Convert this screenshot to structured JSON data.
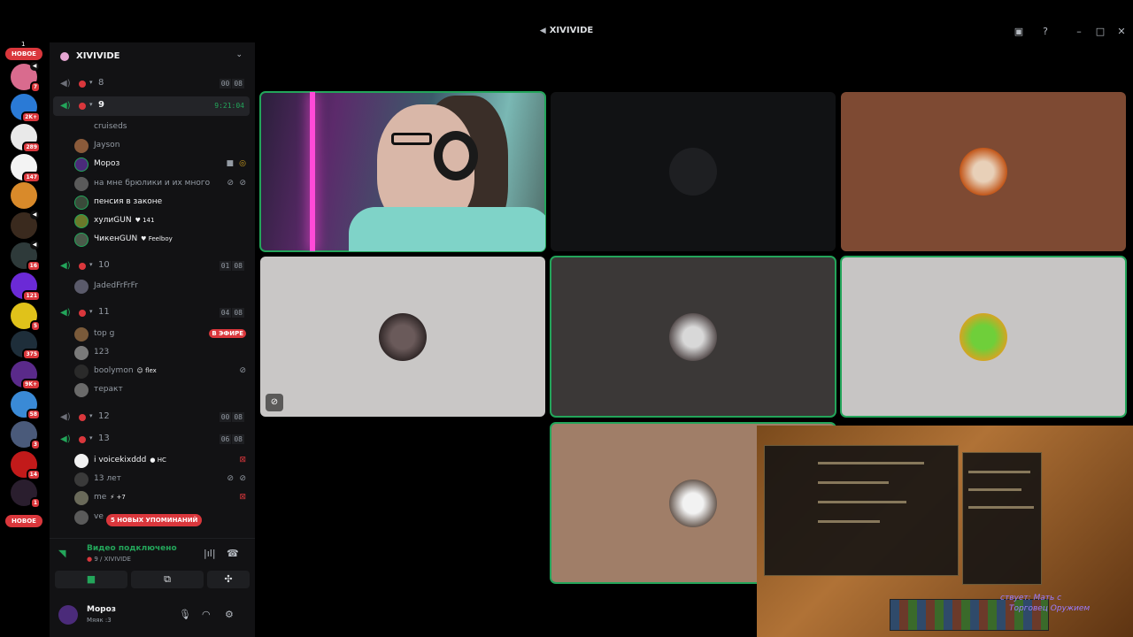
{
  "window": {
    "title": "XIVIVIDE"
  },
  "rail": {
    "new_top": "НОВОЕ",
    "new_bottom": "НОВОЕ",
    "top_count": "1",
    "badges": [
      "7",
      "2K+",
      "289",
      "147",
      "",
      "",
      "16",
      "121",
      "5",
      "375",
      "9K+",
      "58",
      "3",
      "14",
      "1"
    ]
  },
  "server": {
    "name": "XIVIVIDE"
  },
  "channels": {
    "c8": {
      "name": "8",
      "count_a": "00",
      "count_b": "08"
    },
    "c9": {
      "name": "9",
      "timer": "9:21:04"
    },
    "c10": {
      "name": "10",
      "count_a": "01",
      "count_b": "08"
    },
    "c11": {
      "name": "11",
      "count_a": "04",
      "count_b": "08"
    },
    "c12": {
      "name": "12",
      "count_a": "00",
      "count_b": "08"
    },
    "c13": {
      "name": "13",
      "count_a": "06",
      "count_b": "08"
    }
  },
  "users9": {
    "u1": "cruiseds",
    "u2": "Jayson",
    "u3": "Мороз",
    "u4": "на мне брюлики и их много",
    "u5": "пенсия в законе",
    "u6": "хулиGUN",
    "u6_tag": "141",
    "u7": "ЧикенGUN",
    "u7_tag": "Feelboy"
  },
  "users10": {
    "u1": "JadedFrFrFr"
  },
  "users11": {
    "u1": "top g",
    "u1_live": "В ЭФИРЕ",
    "u2": "123",
    "u3": "boolymon",
    "u3_tag": "flex",
    "u4": "теракт"
  },
  "users13": {
    "u1": "i voicekixddd",
    "u1_tag": "HC",
    "u2": "13 лет",
    "u3": "me",
    "u3_tag": "+7",
    "u4": "ve"
  },
  "mentions": "5 НОВЫХ УПОМИНАНИЙ",
  "voice": {
    "title": "Видео подключено",
    "subtitle": "9 / XIVIVIDE"
  },
  "user": {
    "name": "Мороз",
    "status": "Мяяк :3"
  },
  "game_overlay": {
    "line1": "ствует: Мать с",
    "line2": "Торговец Оружием"
  },
  "colors": {
    "green": "#23a55a",
    "red": "#da373c",
    "sidebar": "#121214"
  }
}
